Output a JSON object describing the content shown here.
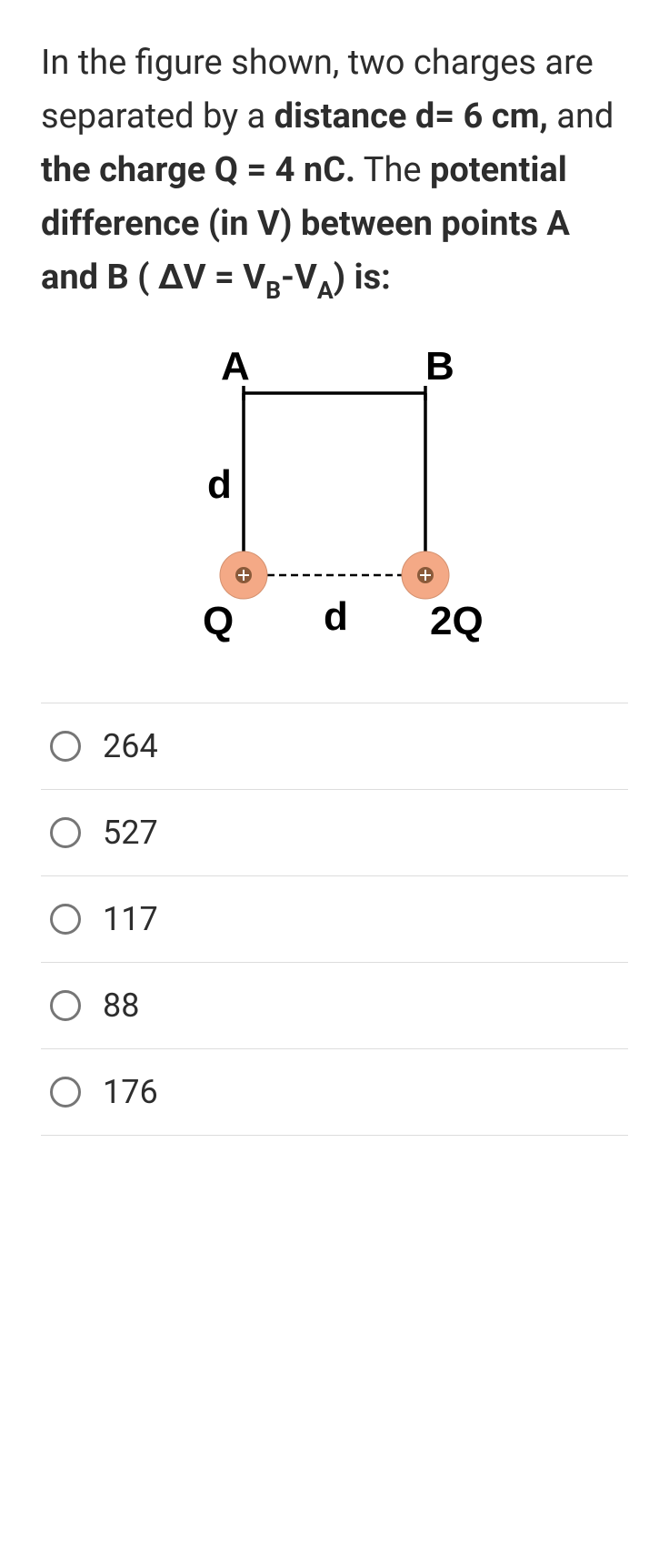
{
  "question": {
    "part1": "In the figure shown, two charges are separated by a ",
    "bold1": "distance d= 6 cm,",
    "part2": " and ",
    "bold2": "the charge Q = 4 nC.",
    "part3": " The ",
    "bold3": "potential difference (in V) between points A and B ( ΔV = V",
    "subB": "B",
    "bold4": "-V",
    "subA": "A",
    "bold5": ") is:"
  },
  "figure": {
    "labelA": "A",
    "labelB": "B",
    "labelD1": "d",
    "labelD2": "d",
    "labelQ": "Q",
    "label2Q": "2Q"
  },
  "options": [
    {
      "label": "264"
    },
    {
      "label": "527"
    },
    {
      "label": "117"
    },
    {
      "label": "88"
    },
    {
      "label": "176"
    }
  ]
}
